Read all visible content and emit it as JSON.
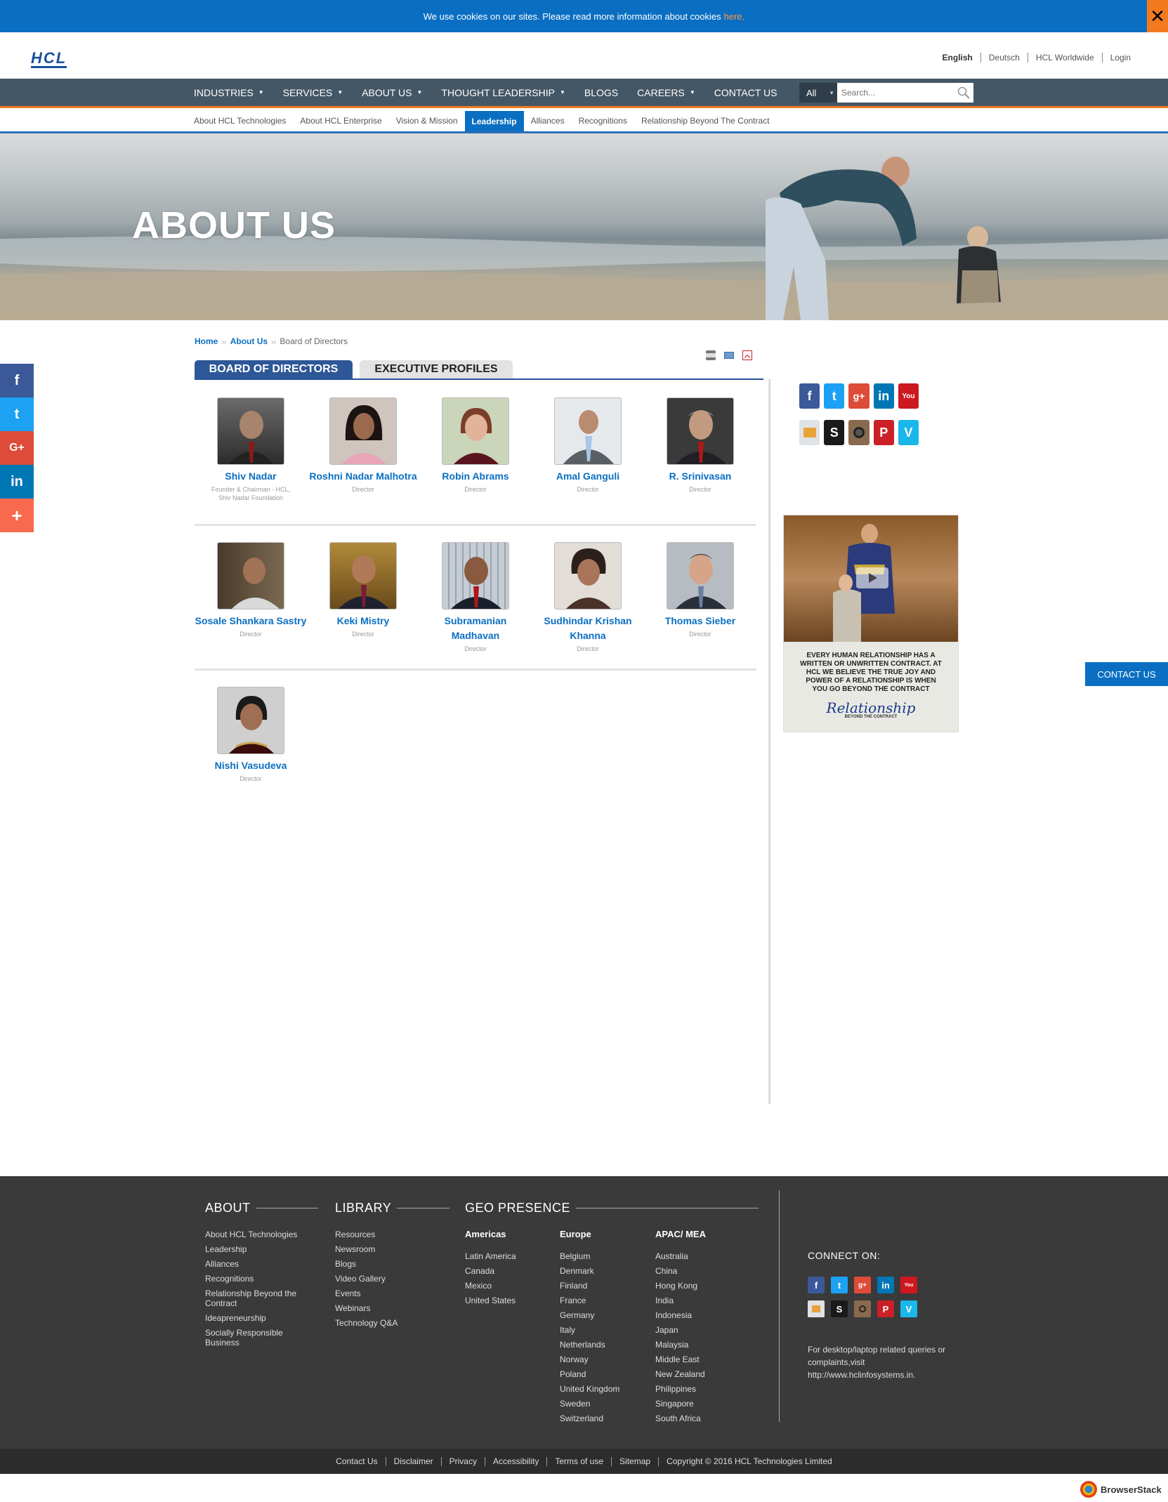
{
  "cookie": {
    "text": "We use cookies on our sites. Please read more information about cookies",
    "link": "here."
  },
  "logo": {
    "text": "HCL"
  },
  "toplinks": [
    "English",
    "Deutsch",
    "HCL Worldwide",
    "Login"
  ],
  "nav": {
    "items": [
      "INDUSTRIES",
      "SERVICES",
      "ABOUT US",
      "THOUGHT LEADERSHIP",
      "BLOGS",
      "CAREERS",
      "CONTACT US"
    ],
    "search_scope": "All",
    "search_placeholder": "Search..."
  },
  "subnav": {
    "items": [
      "About HCL Technologies",
      "About HCL Enterprise",
      "Vision & Mission",
      "Leadership",
      "Alliances",
      "Recognitions",
      "Relationship Beyond The Contract"
    ],
    "active": "Leadership"
  },
  "hero": {
    "title": "ABOUT US"
  },
  "side_social": [
    "facebook-icon",
    "twitter-icon",
    "google-plus-icon",
    "linkedin-icon",
    "share-plus-icon"
  ],
  "breadcrumb": {
    "home": "Home",
    "about": "About Us",
    "current": "Board of Directors",
    "sep": "››"
  },
  "tabs": {
    "board": "BOARD OF DIRECTORS",
    "exec": "EXECUTIVE PROFILES"
  },
  "directors": [
    {
      "name": "Shiv Nadar",
      "role": "Founder & Chairman - HCL, Shiv Nadar Foundation"
    },
    {
      "name": "Roshni Nadar Malhotra",
      "role": "Director"
    },
    {
      "name": "Robin Abrams",
      "role": "Director"
    },
    {
      "name": "Amal Ganguli",
      "role": "Director"
    },
    {
      "name": "R. Srinivasan",
      "role": "Director"
    },
    {
      "name": "Sosale Shankara Sastry",
      "role": "Director"
    },
    {
      "name": "Keki Mistry",
      "role": "Director"
    },
    {
      "name": "Subramanian Madhavan",
      "role": "Director"
    },
    {
      "name": "Sudhindar Krishan Khanna",
      "role": "Director"
    },
    {
      "name": "Thomas Sieber",
      "role": "Director"
    },
    {
      "name": "Nishi Vasudeva",
      "role": "Director"
    }
  ],
  "right_social": [
    "facebook-icon",
    "twitter-icon",
    "google-plus-icon",
    "linkedin-icon",
    "youtube-icon",
    "slideshare-icon",
    "scribd-icon",
    "instagram-icon",
    "pinterest-icon",
    "vimeo-icon"
  ],
  "ad": {
    "text": "EVERY HUMAN RELATIONSHIP HAS A WRITTEN OR UNWRITTEN CONTRACT. AT HCL WE BELIEVE THE TRUE JOY AND POWER OF A RELATIONSHIP IS WHEN YOU GO BEYOND THE CONTRACT",
    "signature": "Relationship",
    "sub": "BEYOND THE CONTRACT"
  },
  "contact_float": "CONTACT US",
  "footer": {
    "about": {
      "title": "ABOUT",
      "items": [
        "About HCL Technologies",
        "Leadership",
        "Alliances",
        "Recognitions",
        "Relationship Beyond the Contract",
        "Ideapreneurship",
        "Socially Responsible Business"
      ]
    },
    "library": {
      "title": "LIBRARY",
      "items": [
        "Resources",
        "Newsroom",
        "Blogs",
        "Video Gallery",
        "Events",
        "Webinars",
        "Technology Q&A"
      ]
    },
    "geo": {
      "title": "GEO PRESENCE",
      "americas": {
        "title": "Americas",
        "items": [
          "Latin America",
          "Canada",
          "Mexico",
          "United States"
        ]
      },
      "europe": {
        "title": "Europe",
        "items": [
          "Belgium",
          "Denmark",
          "Finland",
          "France",
          "Germany",
          "Italy",
          "Netherlands",
          "Norway",
          "Poland",
          "United Kingdom",
          "Sweden",
          "Switzerland"
        ]
      },
      "apac": {
        "title": "APAC/ MEA",
        "items": [
          "Australia",
          "China",
          "Hong Kong",
          "India",
          "Indonesia",
          "Japan",
          "Malaysia",
          "Middle East",
          "New Zealand",
          "Philippines",
          "Singapore",
          "South Africa"
        ]
      }
    },
    "connect_on": "CONNECT ON:",
    "query": "For desktop/laptop related queries or complaints,visit http://www.hclinfosystems.in.",
    "bottom_links": [
      "Contact Us",
      "Disclaimer",
      "Privacy",
      "Accessibility",
      "Terms of use",
      "Sitemap"
    ],
    "copyright": "Copyright © 2016 HCL Technologies Limited"
  },
  "browserstack": "BrowserStack",
  "colors": {
    "brand_blue": "#0a6fc2",
    "nav_bg": "#445766",
    "accent_orange": "#f47a20",
    "tab_active": "#2d5797",
    "footer_bg": "#3a3a3a"
  }
}
